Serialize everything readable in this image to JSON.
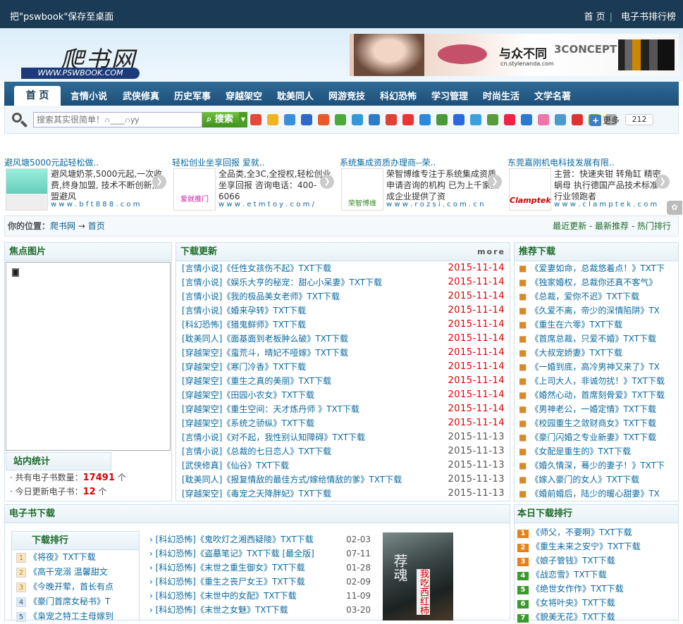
{
  "topbar": {
    "save_text": "把\"pswbook\"保存至桌面",
    "home_link": "首 页",
    "rank_link": "电子书排行榜"
  },
  "logo": {
    "cn": "爬书网",
    "en": "WWW.PSWBOOK.COM"
  },
  "banner": {
    "slogan": "与众不同",
    "url": "cn.stylenanda.com",
    "brand": "3CONCEPT EYES"
  },
  "nav": {
    "home": "首 页",
    "items": [
      "言情小说",
      "武侠修真",
      "历史军事",
      "穿越架空",
      "耽美同人",
      "网游竞技",
      "科幻恐怖",
      "学习管理",
      "时尚生活",
      "文学名著"
    ]
  },
  "search": {
    "placeholder": "搜索其实很简单！∩___∩yy",
    "button": "搜索",
    "more": "更多",
    "count": "212"
  },
  "ads": [
    {
      "title": "避风塘5000元起轻松做..",
      "text": "避风塘奶茶,5000元起,一次收费,终身加盟, 技术不断创新,加盟避风",
      "url": "w w w . b f t 8 8 8 . c o m"
    },
    {
      "title": "轻松创业坐享回报 爱就..",
      "text": "全品类,全3C,全授权,轻松创业坐享回报 咨询电话：400-6066",
      "url": "w w w . e t m t o y . c o m /",
      "logo": "爱就推门"
    },
    {
      "title": "系统集成资质办理商--荣..",
      "text": "荣智博维专注于系统集成资质申请咨询的机构 已为上千家集成企业提供了资",
      "url": "w w w . r o z s i . c o m . c n",
      "logo": "荣智博维"
    },
    {
      "title": "东莞嘉刚机电科技发展有限..",
      "text": "主营：快速夹钳 转角缸 精密蜗母 执行德国产品技术标准 行业领跑者",
      "url": "w w w . c l a m p t e k . c o m",
      "logo": "Clamptek"
    }
  ],
  "breadcrumb": {
    "label": "你的位置：",
    "site": "爬书网",
    "arrow": "→",
    "page": "首页",
    "right": "最近更新 - 最新推荐 - 热门排行"
  },
  "focus": {
    "title": "焦点图片"
  },
  "stats": {
    "title": "站内统计",
    "total_label": "· 共有电子书数量：",
    "total": "17491",
    "total_unit": " 个",
    "today_label": "· 今日更新电子书：",
    "today": "12",
    "today_unit": " 个"
  },
  "downloads": {
    "title": "下载更新",
    "more": "more",
    "items": [
      {
        "t": "[言情小说]《任性女孩伤不起》TXT下载",
        "d": "2015-11-14"
      },
      {
        "t": "[言情小说]《娱乐大亨的秘宠：甜心小呆妻》TXT下载",
        "d": "2015-11-14"
      },
      {
        "t": "[言情小说]《我的极品美女老师》TXT下载",
        "d": "2015-11-14"
      },
      {
        "t": "[言情小说]《婚来孕转》TXT下载",
        "d": "2015-11-14"
      },
      {
        "t": "[科幻恐怖]《猎鬼鲜师》TXT下载",
        "d": "2015-11-14"
      },
      {
        "t": "[耽美同人]《面基面到老板肿么破》TXT下载",
        "d": "2015-11-14"
      },
      {
        "t": "[穿越架空]《蛮荒斗，晴妃不哑嫁》TXT下载",
        "d": "2015-11-14"
      },
      {
        "t": "[穿越架空]《寒门冷香》TXT下载",
        "d": "2015-11-14"
      },
      {
        "t": "[穿越架空]《重生之真的美丽》TXT下载",
        "d": "2015-11-14"
      },
      {
        "t": "[穿越架空]《田园小农女》TXT下载",
        "d": "2015-11-14"
      },
      {
        "t": "[穿越架空]《重生空间：天才炼丹师 》TXT下载",
        "d": "2015-11-14"
      },
      {
        "t": "[穿越架空]《系统之骄纵》TXT下载",
        "d": "2015-11-14"
      },
      {
        "t": "[言情小说]《对不起，我性别认知障碍》TXT下载",
        "d": "2015-11-13"
      },
      {
        "t": "[言情小说]《总裁的七日恋人》TXT下载",
        "d": "2015-11-13"
      },
      {
        "t": "[武侠修真]《仙谷》TXT下载",
        "d": "2015-11-13"
      },
      {
        "t": "[耽美同人]《报复情敌的最佳方式/嫁给情敌的爹》TXT下载",
        "d": "2015-11-13"
      },
      {
        "t": "[穿越架空]《毒宠之天降胖妃》TXT下载",
        "d": "2015-11-13"
      }
    ]
  },
  "recommend": {
    "title": "推荐下载",
    "items": [
      "《爱妻如命，总裁悠着点！》TXT下",
      "《独家婚权，总裁你还真不客气》",
      "《总裁，爱你不迟》TXT下载",
      "《久爱不离，帝少的深情陷阱》TX",
      "《重生在六零》TXT下载",
      "《首席总裁，只爱不婚》TXT下载",
      "《大叔宠娇妻》TXT下载",
      "《一婚到底，高冷男神又来了》TX",
      "《上司大人，非诚勿扰！》TXT下载",
      "《婚然心动，首席刻骨爱》TXT下载",
      "《男神老公，一婚定情》TXT下载",
      "《校园重生之敛财商女》TXT下载",
      "《豪门闪婚之专业新妻》TXT下载",
      "《女配是重生的》TXT下载",
      "《婚久情深，蓦少的妻子！》TXT下",
      "《嫁入豪门的女人》TXT下载",
      "《婚前婚后，陆少的暖心甜妻》TX"
    ]
  },
  "ebook": {
    "title": "电子书下载",
    "rank_title": "下载排行",
    "rank": [
      {
        "n": "1",
        "t": "《将夜》TXT下载"
      },
      {
        "n": "2",
        "t": "《高干宠溺 温馨甜文"
      },
      {
        "n": "3",
        "t": "《今晚开荤，首长有点"
      },
      {
        "n": "4",
        "t": "《豪门首席女秘书》T"
      },
      {
        "n": "5",
        "t": "《枭宠之特工主母嫁到"
      }
    ],
    "list": [
      {
        "t": "[科幻恐怖]《鬼吹灯之湘西疑陵》TXT下载",
        "d": "02-03"
      },
      {
        "t": "[科幻恐怖]《盗墓笔记》TXT下载 [最全版]",
        "d": "07-11"
      },
      {
        "t": "[科幻恐怖]《末世之重生御女》TXT下载",
        "d": "01-28"
      },
      {
        "t": "[科幻恐怖]《重生之丧尸女王》TXT下载",
        "d": "02-09"
      },
      {
        "t": "[科幻恐怖]《末世中的女配》TXT下载",
        "d": "11-09"
      },
      {
        "t": "[科幻恐怖]《末世之女魅》TXT下载",
        "d": "03-20"
      }
    ],
    "cover_title": "荐魂",
    "cover_sub": "我吃西红柿"
  },
  "today": {
    "title": "本日下载排行",
    "items": [
      {
        "n": "1",
        "t": "《师父，不要啊》TXT下载",
        "c": "#e8801a"
      },
      {
        "n": "2",
        "t": "《重生未来之安宁》TXT下载",
        "c": "#e8801a"
      },
      {
        "n": "3",
        "t": "《娘子管钱》TXT下载",
        "c": "#e8801a"
      },
      {
        "n": "4",
        "t": "《战恋雪》TXT下载",
        "c": "#3a9a2a"
      },
      {
        "n": "5",
        "t": "《绝世女作作》TXT下载",
        "c": "#3a9a2a"
      },
      {
        "n": "6",
        "t": "《女将叶央》TXT下载",
        "c": "#3a9a2a"
      },
      {
        "n": "7",
        "t": "《貌美无花》TXT下载",
        "c": "#3a9a2a"
      }
    ]
  }
}
